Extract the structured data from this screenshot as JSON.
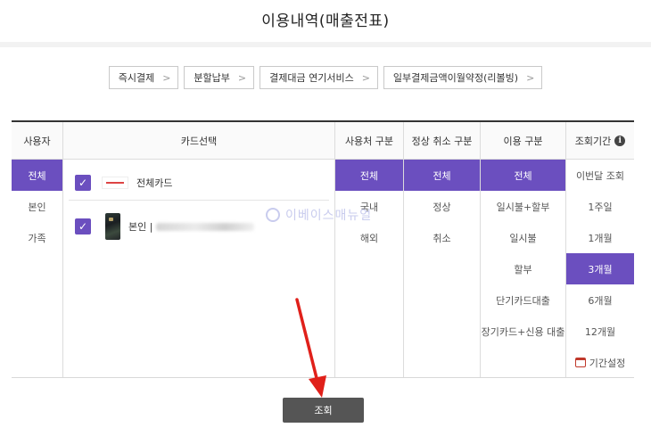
{
  "page": {
    "title": "이용내역(매출전표)"
  },
  "quick_links": [
    {
      "label": "즉시결제"
    },
    {
      "label": "분할납부"
    },
    {
      "label": "결제대금 연기서비스"
    },
    {
      "label": "일부결제금액이월약정(리볼빙)"
    }
  ],
  "columns": {
    "user": {
      "header": "사용자",
      "options": [
        "전체",
        "본인",
        "가족"
      ],
      "selected": "전체"
    },
    "card": {
      "header": "카드선택",
      "items": [
        {
          "label": "전체카드",
          "checked": true
        },
        {
          "label": "본인 | ",
          "checked": true
        }
      ]
    },
    "place": {
      "header": "사용처 구분",
      "options": [
        "전체",
        "국내",
        "해외"
      ],
      "selected": "전체"
    },
    "status": {
      "header": "정상 취소 구분",
      "options": [
        "전체",
        "정상",
        "취소"
      ],
      "selected": "전체"
    },
    "use": {
      "header": "이용 구분",
      "options": [
        "전체",
        "일시불+할부",
        "일시불",
        "할부",
        "단기카드대출",
        "장기카드+신용 대출"
      ],
      "selected": "전체"
    },
    "period": {
      "header": "조회기간",
      "options": [
        "이번달 조회",
        "1주일",
        "1개월",
        "3개월",
        "6개월",
        "12개월"
      ],
      "selected": "3개월",
      "custom_label": "기간설정"
    }
  },
  "watermark": {
    "text": "이베이스매뉴얼"
  },
  "search_button": {
    "label": "조회"
  },
  "colors": {
    "accent": "#6b4fbf",
    "button": "#555555",
    "arrow": "#e0201a"
  }
}
